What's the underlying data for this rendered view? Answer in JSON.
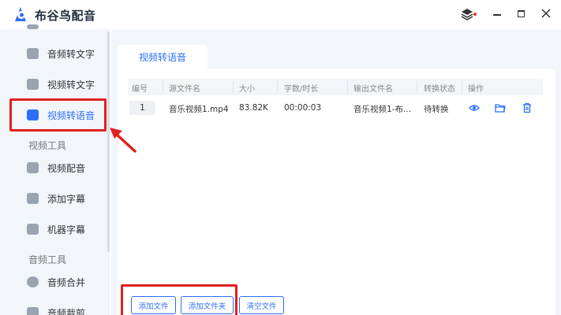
{
  "app": {
    "title": "布谷鸟配音"
  },
  "sidebar": {
    "items": [
      {
        "label": "音频转文字",
        "icon": "audio-to-text-icon"
      },
      {
        "label": "视频转文字",
        "icon": "video-to-text-icon"
      },
      {
        "label": "视频转语音",
        "icon": "video-camera-icon",
        "active": true
      },
      {
        "label": "视频配音",
        "icon": "video-dub-icon"
      },
      {
        "label": "添加字幕",
        "icon": "subtitle-icon"
      },
      {
        "label": "机器字幕",
        "icon": "robot-icon"
      },
      {
        "label": "音频合并",
        "icon": "audio-merge-icon"
      },
      {
        "label": "音频裁剪",
        "icon": "audio-cut-icon"
      }
    ],
    "groups": {
      "video_tools": "视频工具",
      "audio_tools": "音频工具"
    }
  },
  "main": {
    "tab": "视频转语音",
    "table": {
      "headers": [
        "编号",
        "源文件名",
        "大小",
        "字数/时长",
        "输出文件名",
        "转换状态",
        "操作"
      ],
      "rows": [
        {
          "index": "1",
          "source": "音乐视频1.mp4",
          "size": "83.82K",
          "duration": "00:00:03",
          "output": "音乐视频1-布...",
          "status": "待转换"
        }
      ]
    },
    "buttons": {
      "add_file": "添加文件",
      "add_folder": "添加文件夹",
      "clear": "清空文件"
    }
  },
  "colors": {
    "accent": "#2d6ff7",
    "highlight": "#e02020",
    "sidebar_bg": "#f2f5fa"
  }
}
